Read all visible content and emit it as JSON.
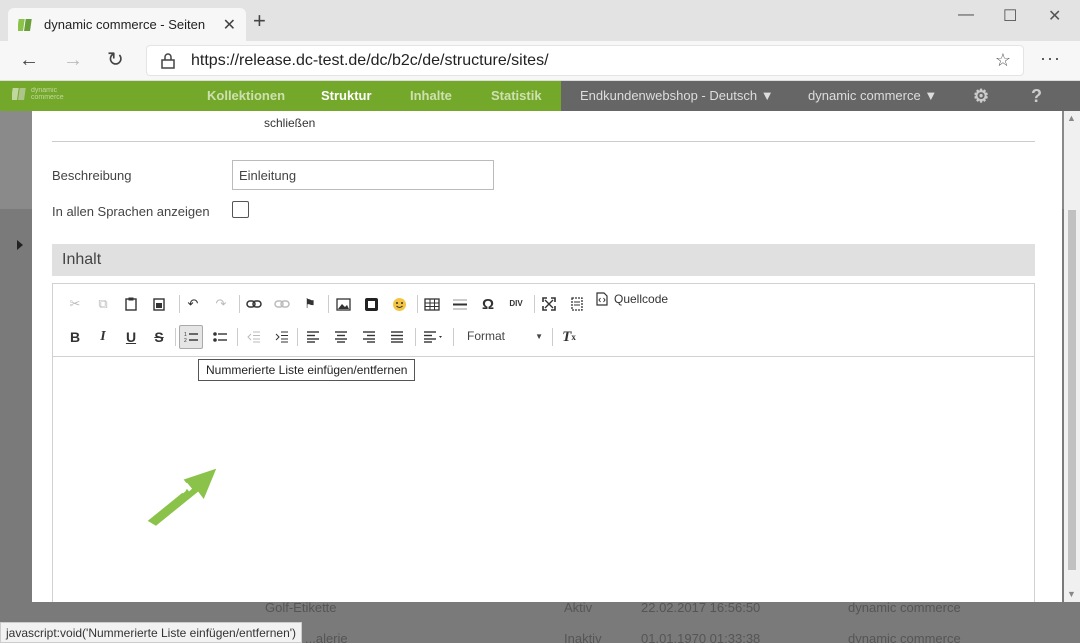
{
  "browser": {
    "tab_title": "dynamic commerce - Seiten",
    "url": "https://release.dc-test.de/dc/b2c/de/structure/sites/",
    "status_text": "javascript:void('Nummerierte Liste einfügen/entfernen')"
  },
  "app": {
    "logo_line1": "dynamic",
    "logo_line2": "commerce",
    "nav": [
      "Kollektionen",
      "Struktur",
      "Inhalte",
      "Statistik"
    ],
    "active_nav": "Struktur",
    "shop_selector": "Endkundenwebshop - Deutsch",
    "user_selector": "dynamic commerce",
    "brand_color": "#74a82a"
  },
  "background_rows": [
    {
      "name": "Golf-Etikette",
      "status": "Aktiv",
      "date": "22.02.2017 16:56:50",
      "owner": "dynamic commerce"
    },
    {
      "name": "...alerie",
      "status": "Inaktiv",
      "date": "01.01.1970 01:33:38",
      "owner": "dynamic commerce"
    }
  ],
  "modal": {
    "cut_text": "schließen",
    "description_label": "Beschreibung",
    "description_value": "Einleitung",
    "all_languages_label": "In allen Sprachen anzeigen",
    "all_languages_checked": false,
    "section_title": "Inhalt"
  },
  "editor": {
    "source_label": "Quellcode",
    "format_label": "Format",
    "tooltip": "Nummerierte Liste einfügen/entfernen",
    "toolbar_row1_icons": [
      "cut-icon",
      "copy-icon",
      "paste-icon",
      "paste-text-icon",
      "paste-word-icon",
      "undo-icon",
      "redo-icon",
      "link-icon",
      "unlink-icon",
      "anchor-icon",
      "image-icon",
      "flash-icon",
      "smiley-icon",
      "table-icon",
      "horizontal-line-icon",
      "special-char-icon",
      "div-icon",
      "maximize-icon",
      "show-blocks-icon",
      "source-icon"
    ],
    "toolbar_row2_icons": [
      "bold-icon",
      "italic-icon",
      "underline-icon",
      "strike-icon",
      "numbered-list-icon",
      "bulleted-list-icon",
      "outdent-icon",
      "indent-icon",
      "align-left-icon",
      "align-center-icon",
      "align-right-icon",
      "justify-icon",
      "bidi-icon",
      "remove-format-icon"
    ]
  }
}
